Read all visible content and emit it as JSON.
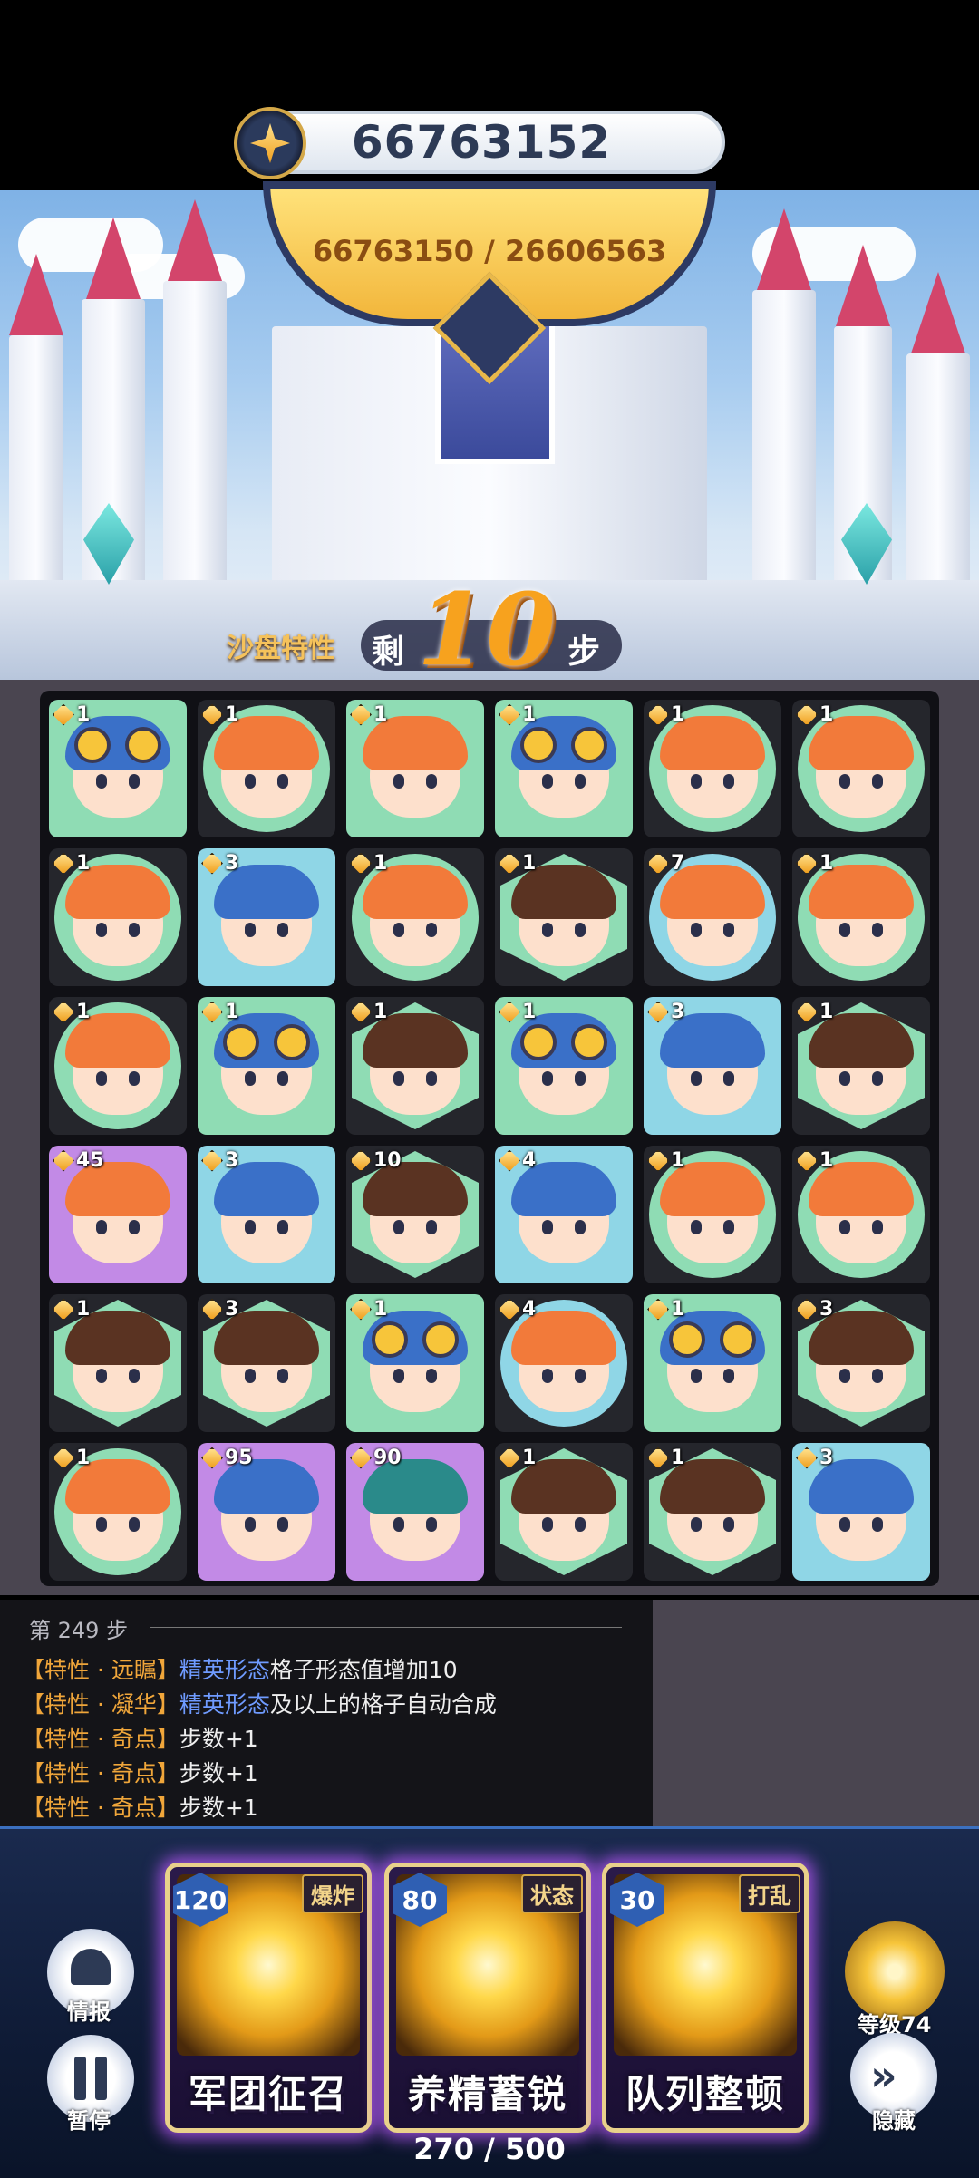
{
  "score": "66763152",
  "target_progress": "66763150 / 26606563",
  "sandbox_label": "沙盘特性",
  "steps": {
    "prefix": "剩",
    "value": "10",
    "suffix": "步"
  },
  "board": [
    [
      {
        "lvl": "1",
        "hair": "blue",
        "goggles": true,
        "bg": "sq-green",
        "frame": "none"
      },
      {
        "lvl": "1",
        "hair": "orange",
        "goggles": false,
        "bg": "dark",
        "frame": "circle"
      },
      {
        "lvl": "1",
        "hair": "orange",
        "goggles": false,
        "bg": "sq-green",
        "frame": "none"
      },
      {
        "lvl": "1",
        "hair": "blue",
        "goggles": true,
        "bg": "sq-green",
        "frame": "none"
      },
      {
        "lvl": "1",
        "hair": "orange",
        "goggles": false,
        "bg": "dark",
        "frame": "circle"
      },
      {
        "lvl": "1",
        "hair": "orange",
        "goggles": false,
        "bg": "dark",
        "frame": "circle"
      }
    ],
    [
      {
        "lvl": "1",
        "hair": "orange",
        "goggles": false,
        "bg": "dark",
        "frame": "circle"
      },
      {
        "lvl": "3",
        "hair": "blue",
        "goggles": false,
        "bg": "sq-cyan",
        "frame": "none"
      },
      {
        "lvl": "1",
        "hair": "orange",
        "goggles": false,
        "bg": "dark",
        "frame": "circle"
      },
      {
        "lvl": "1",
        "hair": "brown",
        "goggles": false,
        "bg": "dark",
        "frame": "hex"
      },
      {
        "lvl": "7",
        "hair": "orange",
        "goggles": false,
        "bg": "dark",
        "frame": "circle-cyan"
      },
      {
        "lvl": "1",
        "hair": "orange",
        "goggles": false,
        "bg": "dark",
        "frame": "circle"
      }
    ],
    [
      {
        "lvl": "1",
        "hair": "orange",
        "goggles": false,
        "bg": "dark",
        "frame": "circle"
      },
      {
        "lvl": "1",
        "hair": "blue",
        "goggles": true,
        "bg": "sq-green",
        "frame": "none"
      },
      {
        "lvl": "1",
        "hair": "brown",
        "goggles": false,
        "bg": "dark",
        "frame": "hex"
      },
      {
        "lvl": "1",
        "hair": "blue",
        "goggles": true,
        "bg": "sq-green",
        "frame": "none"
      },
      {
        "lvl": "3",
        "hair": "blue",
        "goggles": false,
        "bg": "sq-cyan",
        "frame": "none"
      },
      {
        "lvl": "1",
        "hair": "brown",
        "goggles": false,
        "bg": "dark",
        "frame": "hex"
      }
    ],
    [
      {
        "lvl": "45",
        "hair": "orange",
        "goggles": false,
        "bg": "sq-purple",
        "frame": "none"
      },
      {
        "lvl": "3",
        "hair": "blue",
        "goggles": false,
        "bg": "sq-cyan",
        "frame": "none"
      },
      {
        "lvl": "10",
        "hair": "brown",
        "goggles": false,
        "bg": "dark",
        "frame": "hex"
      },
      {
        "lvl": "4",
        "hair": "blue",
        "goggles": false,
        "bg": "sq-cyan",
        "frame": "none"
      },
      {
        "lvl": "1",
        "hair": "orange",
        "goggles": false,
        "bg": "dark",
        "frame": "circle"
      },
      {
        "lvl": "1",
        "hair": "orange",
        "goggles": false,
        "bg": "dark",
        "frame": "circle"
      }
    ],
    [
      {
        "lvl": "1",
        "hair": "brown",
        "goggles": false,
        "bg": "dark",
        "frame": "hex"
      },
      {
        "lvl": "3",
        "hair": "brown",
        "goggles": false,
        "bg": "dark",
        "frame": "hex"
      },
      {
        "lvl": "1",
        "hair": "blue",
        "goggles": true,
        "bg": "sq-green",
        "frame": "none"
      },
      {
        "lvl": "4",
        "hair": "orange",
        "goggles": false,
        "bg": "dark",
        "frame": "circle-cyan"
      },
      {
        "lvl": "1",
        "hair": "blue",
        "goggles": true,
        "bg": "sq-green",
        "frame": "none"
      },
      {
        "lvl": "3",
        "hair": "brown",
        "goggles": false,
        "bg": "dark",
        "frame": "hex"
      }
    ],
    [
      {
        "lvl": "1",
        "hair": "orange",
        "goggles": false,
        "bg": "dark",
        "frame": "circle"
      },
      {
        "lvl": "95",
        "hair": "blue",
        "goggles": false,
        "bg": "sq-purple",
        "frame": "none"
      },
      {
        "lvl": "90",
        "hair": "teal",
        "goggles": false,
        "bg": "sq-purple",
        "frame": "none"
      },
      {
        "lvl": "1",
        "hair": "brown",
        "goggles": false,
        "bg": "dark",
        "frame": "hex"
      },
      {
        "lvl": "1",
        "hair": "brown",
        "goggles": false,
        "bg": "dark",
        "frame": "hex"
      },
      {
        "lvl": "3",
        "hair": "blue",
        "goggles": false,
        "bg": "sq-cyan",
        "frame": "none"
      }
    ]
  ],
  "log": {
    "title": "第 249 步",
    "lines": [
      {
        "tag": "【特性 · 远瞩】",
        "kw": "精英形态",
        "tx": "格子形态值增加10"
      },
      {
        "tag": "【特性 · 凝华】",
        "kw": "精英形态",
        "tx": "及以上的格子自动合成"
      },
      {
        "tag": "【特性 · 奇点】",
        "kw": "",
        "tx": "步数+1"
      },
      {
        "tag": "【特性 · 奇点】",
        "kw": "",
        "tx": "步数+1"
      },
      {
        "tag": "【特性 · 奇点】",
        "kw": "",
        "tx": "步数+1"
      }
    ]
  },
  "skills": [
    {
      "cost": "120",
      "type": "爆炸",
      "name": "军团征召"
    },
    {
      "cost": "80",
      "type": "状态",
      "name": "养精蓄锐"
    },
    {
      "cost": "30",
      "type": "打乱",
      "name": "队列整顿"
    }
  ],
  "energy": "270 / 500",
  "side": {
    "info": "情报",
    "pause": "暂停",
    "level": "等级74",
    "hide": "隐藏"
  }
}
